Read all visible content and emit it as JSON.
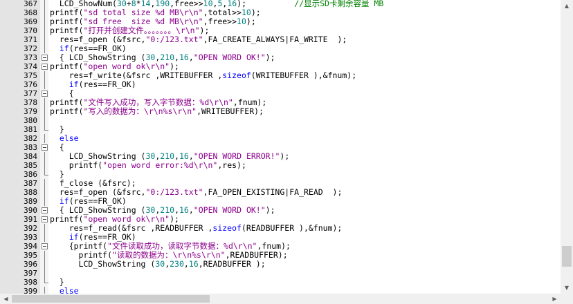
{
  "editor": {
    "lines": [
      {
        "n": "367",
        "fold": "line",
        "code": [
          [
            "",
            "  LCD_ShowNum("
          ],
          [
            "num",
            "30"
          ],
          [
            "",
            "+"
          ],
          [
            "num",
            "8"
          ],
          [
            "",
            "*"
          ],
          [
            "num",
            "14"
          ],
          [
            "",
            ","
          ],
          [
            "num",
            "190"
          ],
          [
            "",
            ",free>>"
          ],
          [
            "num",
            "10"
          ],
          [
            "",
            ","
          ],
          [
            "num",
            "5"
          ],
          [
            "",
            ","
          ],
          [
            "num",
            "16"
          ],
          [
            "",
            ");          "
          ],
          [
            "cmt",
            "//显示SD卡剩余容量 MB"
          ]
        ]
      },
      {
        "n": "368",
        "fold": "line",
        "code": [
          [
            "",
            "printf("
          ],
          [
            "str",
            "\"sd total size %d MB\\r\\n\""
          ],
          [
            "",
            ",total>>"
          ],
          [
            "num",
            "10"
          ],
          [
            "",
            ");"
          ]
        ]
      },
      {
        "n": "369",
        "fold": "line",
        "code": [
          [
            "",
            "printf("
          ],
          [
            "str",
            "\"sd free  size %d MB\\r\\n\""
          ],
          [
            "",
            ",free>>"
          ],
          [
            "num",
            "10"
          ],
          [
            "",
            ");"
          ]
        ]
      },
      {
        "n": "370",
        "fold": "line",
        "code": [
          [
            "",
            "printf("
          ],
          [
            "str",
            "\"打开并创建文件。。。。。。。\\r\\n\""
          ],
          [
            "",
            ");"
          ]
        ]
      },
      {
        "n": "371",
        "fold": "line",
        "code": [
          [
            "",
            "  res=f_open (&fsrc,"
          ],
          [
            "str",
            "\"0:/123.txt\""
          ],
          [
            "",
            ",FA_CREATE_ALWAYS|FA_WRITE  );"
          ]
        ]
      },
      {
        "n": "372",
        "fold": "line",
        "code": [
          [
            "",
            "  "
          ],
          [
            "kw",
            "if"
          ],
          [
            "",
            "(res==FR_OK)"
          ]
        ]
      },
      {
        "n": "373",
        "fold": "box",
        "code": [
          [
            "",
            "  { LCD_ShowString ("
          ],
          [
            "num",
            "30"
          ],
          [
            "",
            ","
          ],
          [
            "num",
            "210"
          ],
          [
            "",
            ","
          ],
          [
            "num",
            "16"
          ],
          [
            "",
            ","
          ],
          [
            "str",
            "\"OPEN WORD OK!\""
          ],
          [
            "",
            ");"
          ]
        ]
      },
      {
        "n": "374",
        "fold": "box",
        "code": [
          [
            "",
            "printf("
          ],
          [
            "str",
            "\"open word ok\\r\\n\""
          ],
          [
            "",
            ");"
          ]
        ]
      },
      {
        "n": "375",
        "fold": "line",
        "code": [
          [
            "",
            "    res=f_write(&fsrc ,WRITEBUFFER ,"
          ],
          [
            "kw",
            "sizeof"
          ],
          [
            "",
            "(WRITEBUFFER ),&fnum);"
          ]
        ]
      },
      {
        "n": "376",
        "fold": "line",
        "code": [
          [
            "",
            "    "
          ],
          [
            "kw",
            "if"
          ],
          [
            "",
            "(res==FR_OK)"
          ]
        ]
      },
      {
        "n": "377",
        "fold": "box",
        "code": [
          [
            "",
            "    {"
          ]
        ]
      },
      {
        "n": "378",
        "fold": "line",
        "code": [
          [
            "",
            "printf("
          ],
          [
            "str",
            "\"文件写入成功，写入字节数据：%d\\r\\n\""
          ],
          [
            "",
            ",fnum);"
          ]
        ]
      },
      {
        "n": "379",
        "fold": "line",
        "code": [
          [
            "",
            "printf("
          ],
          [
            "str",
            "\"写入的数据为：\\r\\n%s\\r\\n\""
          ],
          [
            "",
            ",WRITEBUFFER);"
          ]
        ]
      },
      {
        "n": "380",
        "fold": "line",
        "code": []
      },
      {
        "n": "381",
        "fold": "end",
        "code": [
          [
            "",
            "  }"
          ]
        ]
      },
      {
        "n": "382",
        "fold": "line",
        "code": [
          [
            "",
            "  "
          ],
          [
            "kw",
            "else"
          ]
        ]
      },
      {
        "n": "383",
        "fold": "box",
        "code": [
          [
            "",
            "  {"
          ]
        ]
      },
      {
        "n": "384",
        "fold": "line",
        "code": [
          [
            "",
            "    LCD_ShowString ("
          ],
          [
            "num",
            "30"
          ],
          [
            "",
            ","
          ],
          [
            "num",
            "210"
          ],
          [
            "",
            ","
          ],
          [
            "num",
            "16"
          ],
          [
            "",
            ","
          ],
          [
            "str",
            "\"OPEN WORD ERROR!\""
          ],
          [
            "",
            ");"
          ]
        ]
      },
      {
        "n": "385",
        "fold": "line",
        "code": [
          [
            "",
            "    printf("
          ],
          [
            "str",
            "\"open word error:%d\\r\\n\""
          ],
          [
            "",
            ",res);"
          ]
        ]
      },
      {
        "n": "386",
        "fold": "end",
        "code": [
          [
            "",
            "  }"
          ]
        ]
      },
      {
        "n": "387",
        "fold": "line",
        "code": [
          [
            "",
            "  f_close (&fsrc);"
          ]
        ]
      },
      {
        "n": "388",
        "fold": "line",
        "code": [
          [
            "",
            "  res=f_open (&fsrc,"
          ],
          [
            "str",
            "\"0:/123.txt\""
          ],
          [
            "",
            ",FA_OPEN_EXISTING|FA_READ  );"
          ]
        ]
      },
      {
        "n": "389",
        "fold": "line",
        "code": [
          [
            "",
            "  "
          ],
          [
            "kw",
            "if"
          ],
          [
            "",
            "(res==FR_OK)"
          ]
        ]
      },
      {
        "n": "390",
        "fold": "box",
        "code": [
          [
            "",
            "  { LCD_ShowString ("
          ],
          [
            "num",
            "30"
          ],
          [
            "",
            ","
          ],
          [
            "num",
            "210"
          ],
          [
            "",
            ","
          ],
          [
            "num",
            "16"
          ],
          [
            "",
            ","
          ],
          [
            "str",
            "\"OPEN WORD OK!\""
          ],
          [
            "",
            ");"
          ]
        ]
      },
      {
        "n": "391",
        "fold": "box",
        "code": [
          [
            "",
            "printf("
          ],
          [
            "str",
            "\"open word ok\\r\\n\""
          ],
          [
            "",
            ");"
          ]
        ]
      },
      {
        "n": "392",
        "fold": "line",
        "code": [
          [
            "",
            "    res=f_read(&fsrc ,READBUFFER ,"
          ],
          [
            "kw",
            "sizeof"
          ],
          [
            "",
            "(READBUFFER ),&fnum);"
          ]
        ]
      },
      {
        "n": "393",
        "fold": "line",
        "code": [
          [
            "",
            "    "
          ],
          [
            "kw",
            "if"
          ],
          [
            "",
            "(res==FR_OK)"
          ]
        ]
      },
      {
        "n": "394",
        "fold": "box",
        "code": [
          [
            "",
            "    {printf("
          ],
          [
            "str",
            "\"文件读取成功，读取字节数据：%d\\r\\n\""
          ],
          [
            "",
            ",fnum);"
          ]
        ]
      },
      {
        "n": "395",
        "fold": "line",
        "code": [
          [
            "",
            "      printf("
          ],
          [
            "str",
            "\"读取的数据为：\\r\\n%s\\r\\n\""
          ],
          [
            "",
            ",READBUFFER);"
          ]
        ]
      },
      {
        "n": "396",
        "fold": "line",
        "code": [
          [
            "",
            "      LCD_ShowString ("
          ],
          [
            "num",
            "30"
          ],
          [
            "",
            ","
          ],
          [
            "num",
            "230"
          ],
          [
            "",
            ","
          ],
          [
            "num",
            "16"
          ],
          [
            "",
            ",READBUFFER );"
          ]
        ]
      },
      {
        "n": "397",
        "fold": "line",
        "code": []
      },
      {
        "n": "398",
        "fold": "end",
        "code": [
          [
            "",
            "  }"
          ]
        ]
      },
      {
        "n": "399",
        "fold": "line",
        "code": [
          [
            "",
            "  "
          ],
          [
            "kw",
            "else"
          ]
        ]
      }
    ]
  },
  "scrollbars": {
    "up_arrow": "▲",
    "down_arrow": "▼",
    "left_arrow": "◀",
    "right_arrow": "▶"
  }
}
